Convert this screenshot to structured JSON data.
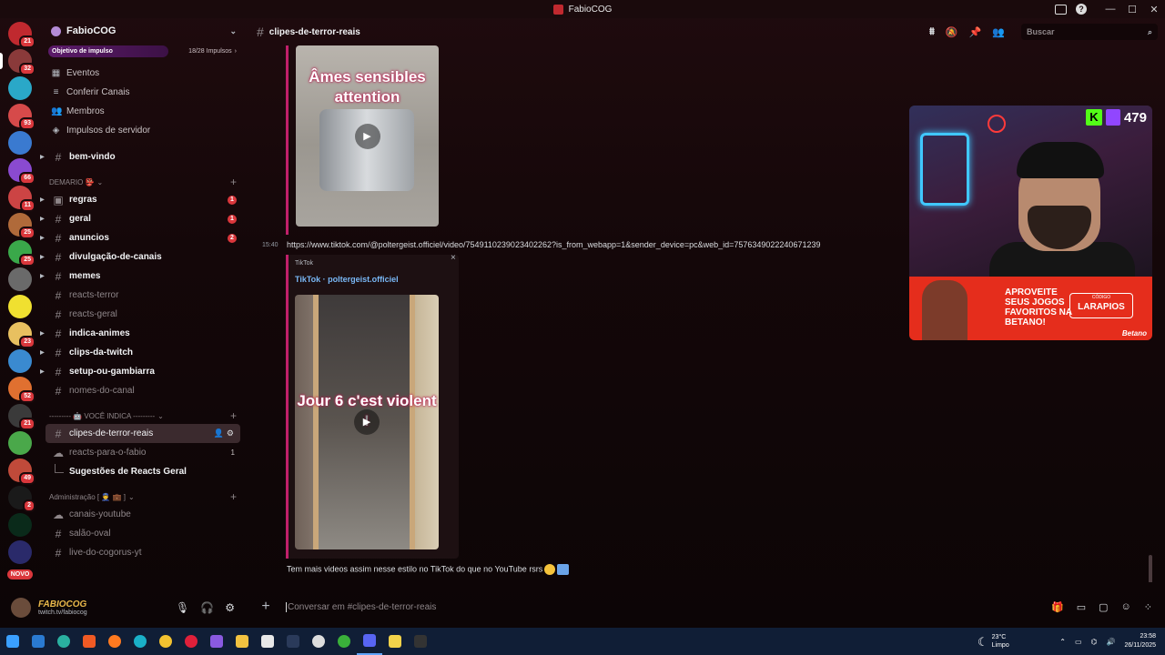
{
  "window": {
    "title": "FabioCOG"
  },
  "servers": [
    {
      "badge": "21",
      "color": "#c0292f"
    },
    {
      "badge": "32",
      "color": "#8a3a3a"
    },
    {
      "badge": "",
      "color": "#2aa8c8"
    },
    {
      "badge": "93",
      "color": "#d64a4a"
    },
    {
      "badge": "",
      "color": "#3a7ad0"
    },
    {
      "badge": "66",
      "color": "#8a4ad0"
    },
    {
      "badge": "11",
      "color": "#c44"
    },
    {
      "badge": "25",
      "color": "#b06a3a"
    },
    {
      "badge": "25",
      "color": "#3aa84a"
    },
    {
      "badge": "",
      "color": "#6a6a6a"
    },
    {
      "badge": "",
      "color": "#f0e030"
    },
    {
      "badge": "23",
      "color": "#e8c060"
    },
    {
      "badge": "",
      "color": "#3a8ad0"
    },
    {
      "badge": "52",
      "color": "#e07030"
    },
    {
      "badge": "21",
      "color": "#3a3a3a"
    },
    {
      "badge": "",
      "color": "#4aa84a"
    },
    {
      "badge": "49",
      "color": "#c04a3a"
    },
    {
      "badge": "2",
      "color": "#1a1a1a"
    },
    {
      "badge": "",
      "color": "#0a2a1a"
    },
    {
      "badge": "",
      "color": "#2a2a6a"
    }
  ],
  "novo_label": "NOVO",
  "guild": {
    "name": "FabioCOG",
    "boost_label": "Objetivo de impulso",
    "boost_count": "18/28 Impulsos",
    "boost_progress": 0.64
  },
  "nav": [
    {
      "icon": "calendar-icon",
      "glyph": "▦",
      "label": "Eventos"
    },
    {
      "icon": "channels-icon",
      "glyph": "≡",
      "label": "Conferir Canais"
    },
    {
      "icon": "members-icon",
      "glyph": "👥",
      "label": "Membros"
    },
    {
      "icon": "boost-icon",
      "glyph": "◈",
      "label": "Impulsos de servidor"
    }
  ],
  "top_channels": [
    {
      "name": "bem-vindo",
      "unread": true,
      "arrow": true
    }
  ],
  "categories": [
    {
      "label": "DEMARIO 👺",
      "channels": [
        {
          "name": "regras",
          "unread": true,
          "arrow": true,
          "glyph": "▣",
          "mention": "1"
        },
        {
          "name": "geral",
          "unread": true,
          "arrow": true,
          "glyph": "#",
          "mention": "1"
        },
        {
          "name": "anuncios",
          "unread": true,
          "arrow": true,
          "glyph": "#",
          "mention": "2"
        },
        {
          "name": "divulgação-de-canais",
          "unread": true,
          "arrow": true,
          "glyph": "#"
        },
        {
          "name": "memes",
          "unread": true,
          "arrow": true,
          "glyph": "#"
        },
        {
          "name": "reacts-terror",
          "unread": false,
          "arrow": false,
          "glyph": "#"
        },
        {
          "name": "reacts-geral",
          "unread": false,
          "arrow": false,
          "glyph": "#"
        },
        {
          "name": "indica-animes",
          "unread": true,
          "arrow": true,
          "glyph": "#"
        },
        {
          "name": "clips-da-twitch",
          "unread": true,
          "arrow": true,
          "glyph": "#"
        },
        {
          "name": "setup-ou-gambiarra",
          "unread": true,
          "arrow": true,
          "glyph": "#"
        },
        {
          "name": "nomes-do-canal",
          "unread": false,
          "arrow": false,
          "glyph": "#"
        }
      ]
    },
    {
      "label": "--------- 🤖 VOCÊ INDICA ---------",
      "channels": [
        {
          "name": "clipes-de-terror-reais",
          "selected": true,
          "glyph": "#",
          "tools": true
        },
        {
          "name": "reacts-para-o-fabio",
          "unread": false,
          "glyph": "☁",
          "num": "1"
        }
      ],
      "thread": "Sugestões de Reacts Geral"
    },
    {
      "label": "Administração [ 👮 💼 ]",
      "channels": [
        {
          "name": "canais-youtube",
          "unread": false,
          "glyph": "☁"
        },
        {
          "name": "salão-oval",
          "unread": false,
          "glyph": "#"
        },
        {
          "name": "live-do-cogorus-yt",
          "unread": false,
          "glyph": "#"
        }
      ]
    }
  ],
  "user": {
    "name": "FABIOCOG",
    "status": "twitch.tv/fabiocog"
  },
  "channel": {
    "name": "clipes-de-terror-reais"
  },
  "search": {
    "placeholder": "Buscar"
  },
  "messages": {
    "first_video_caption": "Âmes sensibles attention",
    "time": "15:40",
    "url": "https://www.tiktok.com/@poltergeist.officiel/video/7549110239023402262?is_from_webapp=1&sender_device=pc&web_id=7576349022240671239",
    "provider": "TikTok",
    "embed_title": "TikTok · poltergeist.officiel",
    "second_video_caption": "Jour 6 c'est violent !",
    "followup": "Tem mais videos assim nesse estilo no TikTok do que no YouTube rsrs"
  },
  "composer": {
    "placeholder": "Conversar em #clipes-de-terror-reais"
  },
  "overlay": {
    "viewers": "479",
    "ad_text": "APROVEITE SEUS JOGOS FAVORITOS NA BETANO!",
    "ad_code_label": "CÓDIGO",
    "ad_code": "LARAPIOS",
    "ad_brand": "Betano"
  },
  "taskbar": {
    "weather_temp": "23°C",
    "weather_desc": "Limpo",
    "time": "23:58",
    "date": "26/11/2025"
  }
}
